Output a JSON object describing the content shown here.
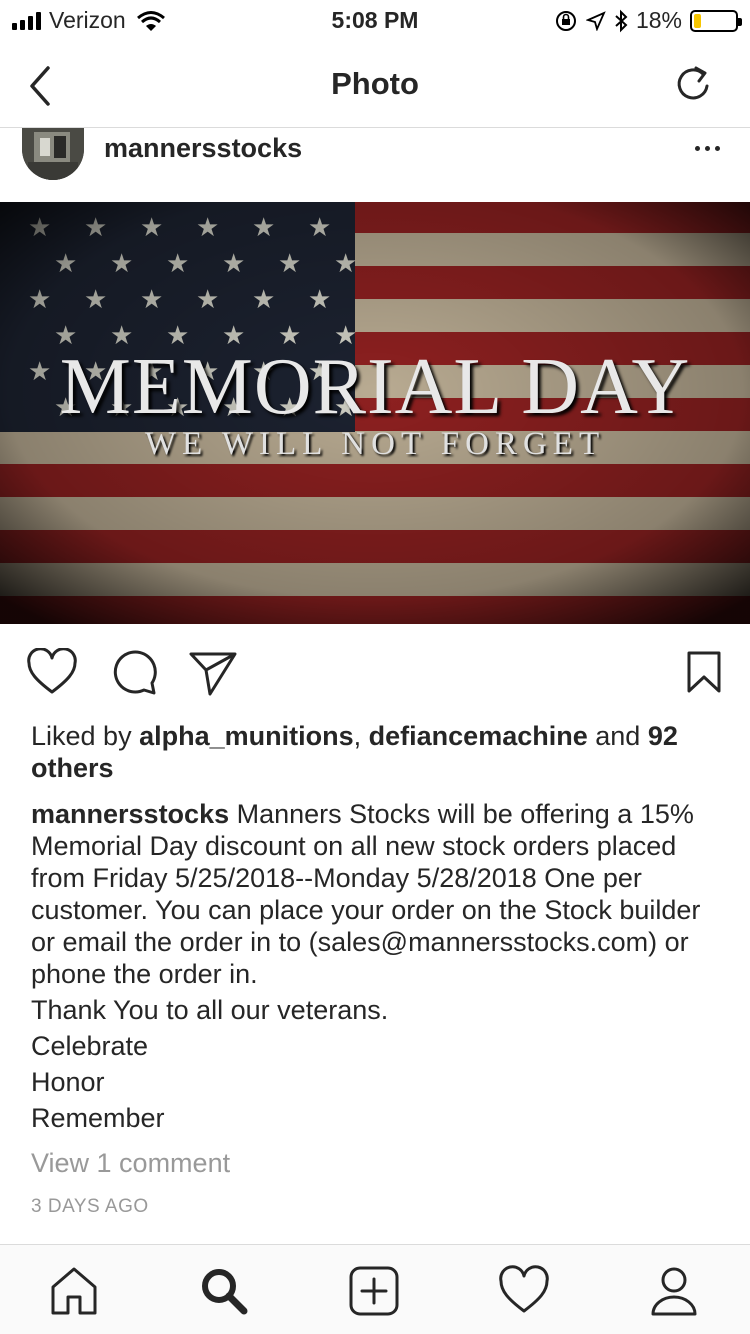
{
  "status_bar": {
    "carrier": "Verizon",
    "time": "5:08 PM",
    "battery_pct": "18%",
    "battery_level": 0.18,
    "battery_color": "#f7c600"
  },
  "nav": {
    "title": "Photo",
    "back_icon": "chevron-left-icon",
    "refresh_icon": "refresh-icon"
  },
  "post": {
    "username": "mannersstocks",
    "image": {
      "headline": "MEMORIAL DAY",
      "subtitle": "WE WILL NOT FORGET"
    },
    "likes": {
      "prefix": "Liked by",
      "user1": "alpha_munitions",
      "sep": ",",
      "user2": "defiancemachine",
      "and": "and",
      "others": "92 others"
    },
    "caption": {
      "username": "mannersstocks",
      "text": "Manners Stocks will be offering a 15%  Memorial Day discount on all new stock orders placed from Friday 5/25/2018--Monday 5/28/2018 One per customer. You can place your order on the Stock builder or email the order in to (sales@mannersstocks.com) or phone the order in.",
      "lines": [
        "Thank You to all our veterans.",
        "Celebrate",
        "Honor",
        "Remember"
      ]
    },
    "view_comments": "View 1 comment",
    "timestamp": "3 DAYS AGO"
  },
  "tabbar": [
    "home-icon",
    "search-icon",
    "add-post-icon",
    "activity-heart-icon",
    "profile-icon"
  ]
}
